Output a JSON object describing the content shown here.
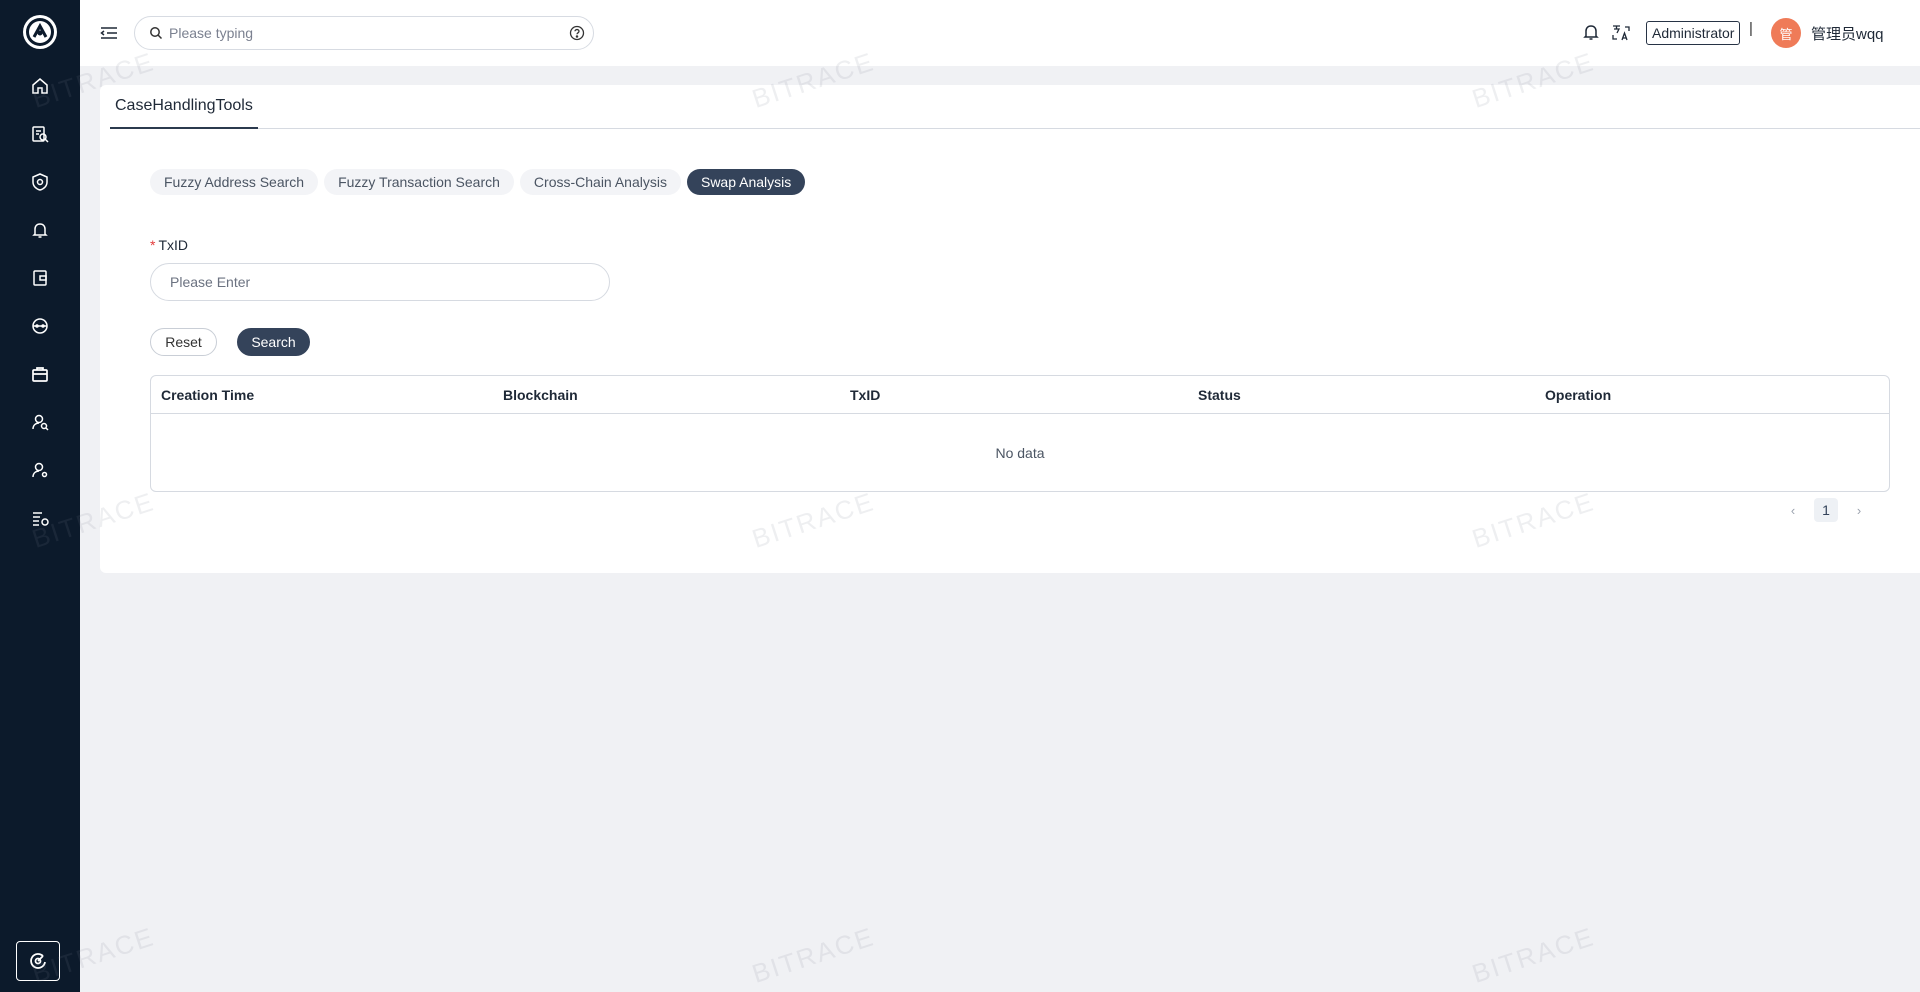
{
  "header": {
    "search_placeholder": "Please typing",
    "role_badge": "Administrator",
    "separator": "|",
    "avatar_initial": "管",
    "username": "管理员wqq"
  },
  "page_tab": "CaseHandlingTools",
  "tool_tabs": [
    {
      "label": "Fuzzy Address Search",
      "active": false
    },
    {
      "label": "Fuzzy Transaction Search",
      "active": false
    },
    {
      "label": "Cross-Chain Analysis",
      "active": false
    },
    {
      "label": "Swap Analysis",
      "active": true
    }
  ],
  "form": {
    "required_mark": "*",
    "txid_label": "TxID",
    "txid_placeholder": "Please Enter",
    "txid_value": ""
  },
  "buttons": {
    "reset": "Reset",
    "search": "Search"
  },
  "table": {
    "columns": [
      "Creation Time",
      "Blockchain",
      "TxID",
      "Status",
      "Operation"
    ],
    "rows": [],
    "empty_text": "No data"
  },
  "pagination": {
    "current_page": "1",
    "prev": "‹",
    "next": "›"
  },
  "watermark": "BITRACE",
  "colors": {
    "sidebar": "#0c1a2b",
    "accent": "#34435a",
    "avatar": "#ef7b58",
    "required": "#e23b3b"
  },
  "sidebar_icons": [
    "home-icon",
    "report-search-icon",
    "shield-icon",
    "bell-icon",
    "wallet-icon",
    "chain-icon",
    "toolbox-icon",
    "user-search-icon",
    "user-settings-icon",
    "list-coins-icon"
  ]
}
